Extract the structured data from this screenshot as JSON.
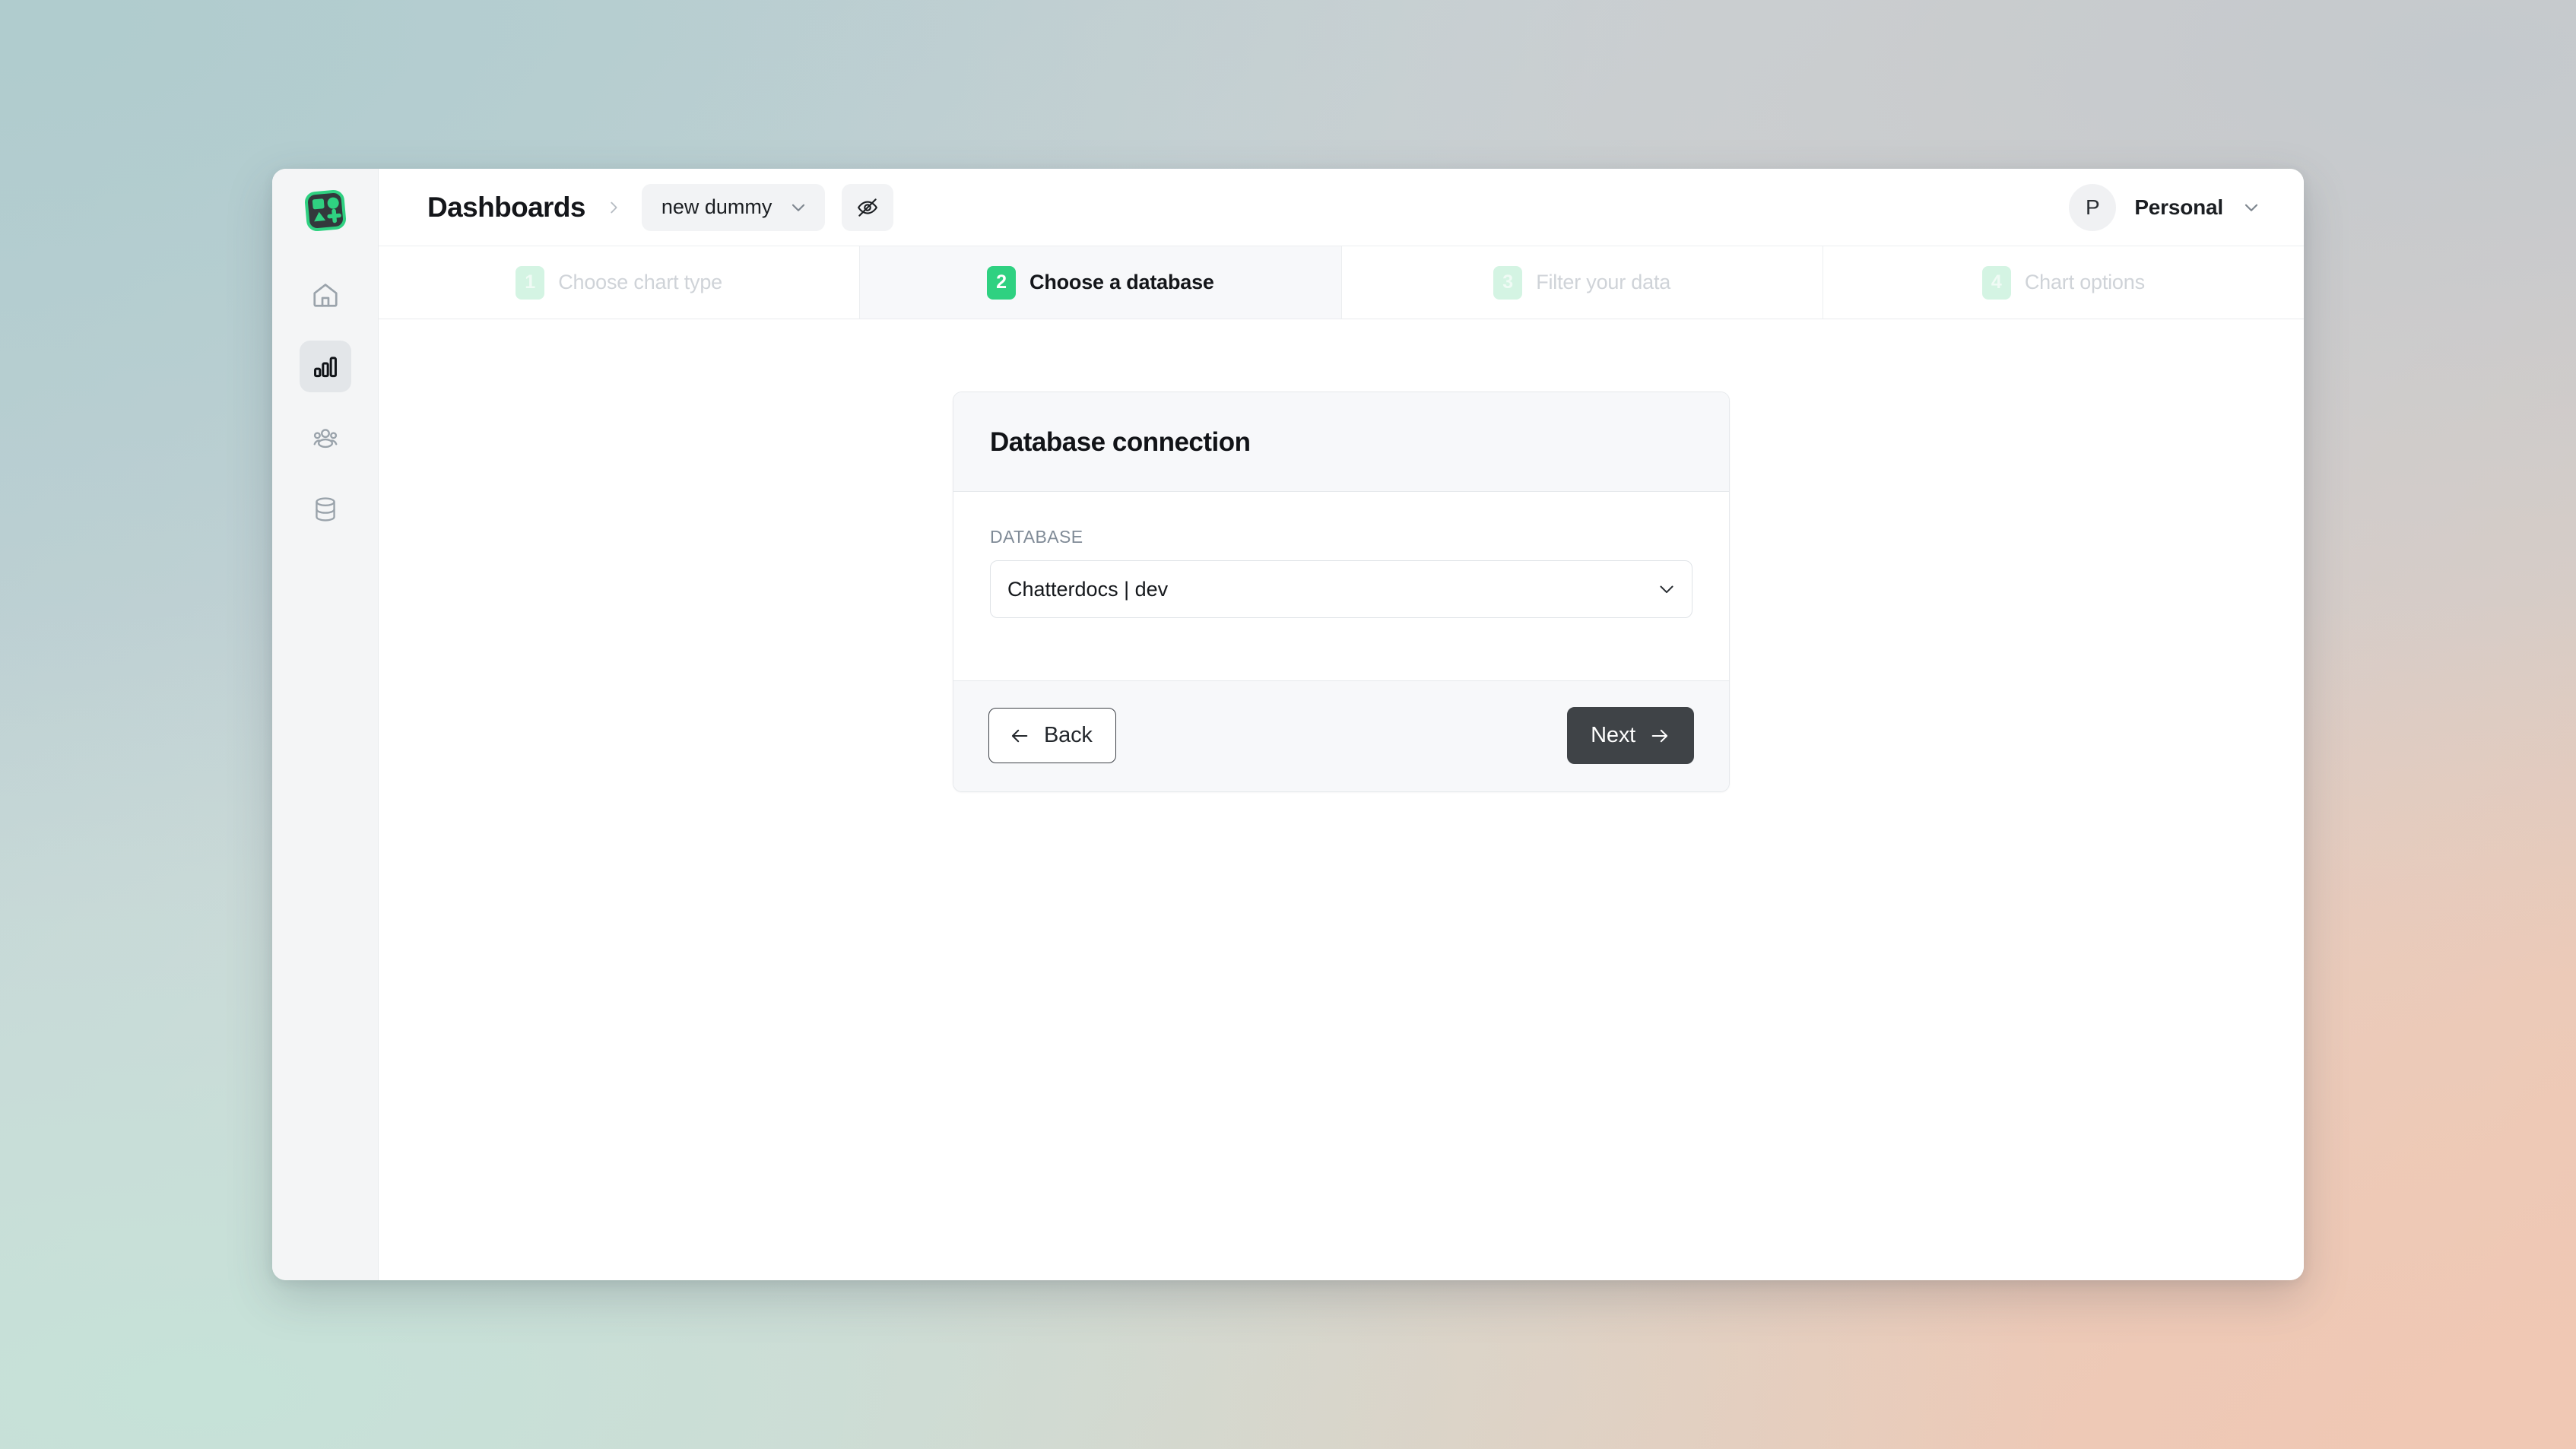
{
  "brand": {
    "logo_icon": "shapes-plus-logo"
  },
  "sidebar": {
    "items": [
      {
        "name": "home",
        "icon": "home-icon",
        "active": false
      },
      {
        "name": "dashboards",
        "icon": "bar-chart-icon",
        "active": true
      },
      {
        "name": "team",
        "icon": "users-icon",
        "active": false
      },
      {
        "name": "databases",
        "icon": "database-icon",
        "active": false
      }
    ]
  },
  "topbar": {
    "breadcrumb_root": "Dashboards",
    "breadcrumb_separator_icon": "chevron-right-icon",
    "dashboard_select": {
      "value": "new dummy",
      "chevron_icon": "chevron-down-icon"
    },
    "visibility_toggle": {
      "icon": "eye-off-icon"
    },
    "account": {
      "avatar_initial": "P",
      "name": "Personal",
      "chevron_icon": "chevron-down-icon"
    }
  },
  "stepper": {
    "steps": [
      {
        "number": "1",
        "label": "Choose chart type",
        "state": "idle"
      },
      {
        "number": "2",
        "label": "Choose a database",
        "state": "active"
      },
      {
        "number": "3",
        "label": "Filter your data",
        "state": "idle"
      },
      {
        "number": "4",
        "label": "Chart options",
        "state": "idle"
      }
    ]
  },
  "card": {
    "title": "Database connection",
    "database_field": {
      "label": "DATABASE",
      "value": "Chatterdocs | dev",
      "chevron_icon": "chevron-down-icon"
    },
    "footer": {
      "back_label": "Back",
      "back_icon": "arrow-left-icon",
      "next_label": "Next",
      "next_icon": "arrow-right-icon"
    }
  },
  "colors": {
    "accent_green": "#2fd181",
    "accent_green_muted": "#d4f4e3",
    "dark_button": "#3f4347",
    "card_header_bg": "#f7f8fa",
    "sidebar_bg": "#f4f5f6"
  }
}
